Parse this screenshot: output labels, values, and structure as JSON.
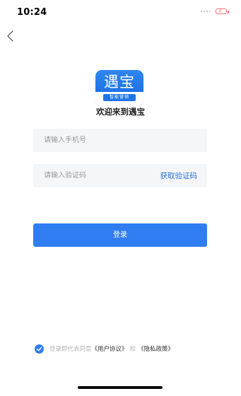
{
  "status_bar": {
    "time": "10:24"
  },
  "logo": {
    "main_text": "遇宝",
    "sub_text": "智能营销"
  },
  "welcome_text": "欢迎来到遇宝",
  "form": {
    "phone_placeholder": "请输入手机号",
    "phone_value": "",
    "code_placeholder": "请输入验证码",
    "code_value": "",
    "get_code_label": "获取验证码",
    "login_label": "登录"
  },
  "agreement": {
    "checked": true,
    "prefix": "登录即代表同意",
    "user_agreement": "《用户协议》",
    "conjunction": "和",
    "privacy_policy": "《隐私政策》"
  },
  "icons": {
    "back": "chevron-left-icon",
    "check": "check-circle-icon",
    "battery": "battery-charging-icon"
  },
  "colors": {
    "primary": "#2f7df1",
    "link": "#2b72d8",
    "field_bg": "#f5f6f8",
    "battery": "#f07070"
  }
}
